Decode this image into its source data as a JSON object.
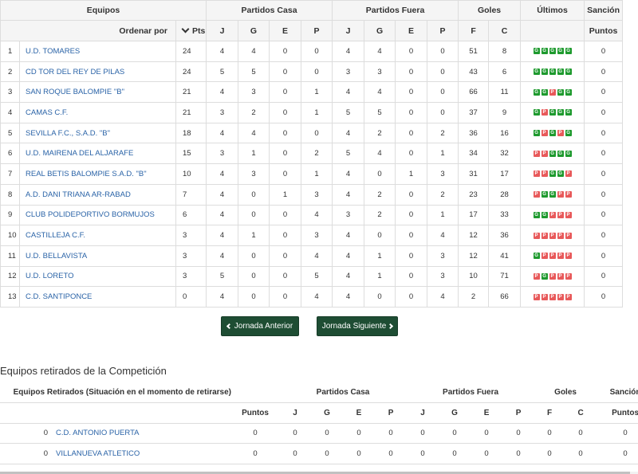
{
  "standings": {
    "header_groups": {
      "teams": "Equipos",
      "home": "Partidos Casa",
      "away": "Partidos Fuera",
      "goals": "Goles",
      "last": "Últimos",
      "penalty": "Sanción"
    },
    "order_by": "Ordenar por",
    "pts": "Pts",
    "cols": {
      "j": "J",
      "g": "G",
      "e": "E",
      "p": "P",
      "f": "F",
      "c": "C",
      "points": "Puntos"
    },
    "rows": [
      {
        "pos": "1",
        "team": "U.D. TOMARES",
        "pts": "24",
        "hj": "4",
        "hg": "4",
        "he": "0",
        "hp": "0",
        "aj": "4",
        "ag": "4",
        "ae": "0",
        "ap": "0",
        "f": "51",
        "c": "8",
        "last": [
          "G",
          "G",
          "G",
          "G",
          "G"
        ],
        "pen": "0"
      },
      {
        "pos": "2",
        "team": "CD TOR DEL REY DE PILAS",
        "pts": "24",
        "hj": "5",
        "hg": "5",
        "he": "0",
        "hp": "0",
        "aj": "3",
        "ag": "3",
        "ae": "0",
        "ap": "0",
        "f": "43",
        "c": "6",
        "last": [
          "G",
          "G",
          "G",
          "G",
          "G"
        ],
        "pen": "0"
      },
      {
        "pos": "3",
        "team": "SAN ROQUE BALOMPIE \"B\"",
        "pts": "21",
        "hj": "4",
        "hg": "3",
        "he": "0",
        "hp": "1",
        "aj": "4",
        "ag": "4",
        "ae": "0",
        "ap": "0",
        "f": "66",
        "c": "11",
        "last": [
          "G",
          "G",
          "P",
          "G",
          "G"
        ],
        "pen": "0"
      },
      {
        "pos": "4",
        "team": "CAMAS C.F.",
        "pts": "21",
        "hj": "3",
        "hg": "2",
        "he": "0",
        "hp": "1",
        "aj": "5",
        "ag": "5",
        "ae": "0",
        "ap": "0",
        "f": "37",
        "c": "9",
        "last": [
          "G",
          "P",
          "G",
          "G",
          "G"
        ],
        "pen": "0"
      },
      {
        "pos": "5",
        "team": "SEVILLA F.C., S.A.D. \"B\"",
        "pts": "18",
        "hj": "4",
        "hg": "4",
        "he": "0",
        "hp": "0",
        "aj": "4",
        "ag": "2",
        "ae": "0",
        "ap": "2",
        "f": "36",
        "c": "16",
        "last": [
          "G",
          "P",
          "G",
          "P",
          "G"
        ],
        "pen": "0"
      },
      {
        "pos": "6",
        "team": "U.D. MAIRENA DEL ALJARAFE",
        "pts": "15",
        "hj": "3",
        "hg": "1",
        "he": "0",
        "hp": "2",
        "aj": "5",
        "ag": "4",
        "ae": "0",
        "ap": "1",
        "f": "34",
        "c": "32",
        "last": [
          "P",
          "P",
          "G",
          "G",
          "G"
        ],
        "pen": "0"
      },
      {
        "pos": "7",
        "team": "REAL BETIS BALOMPIE S.A.D. \"B\"",
        "pts": "10",
        "hj": "4",
        "hg": "3",
        "he": "0",
        "hp": "1",
        "aj": "4",
        "ag": "0",
        "ae": "1",
        "ap": "3",
        "f": "31",
        "c": "17",
        "last": [
          "P",
          "P",
          "G",
          "G",
          "P"
        ],
        "pen": "0"
      },
      {
        "pos": "8",
        "team": "A.D. DANI TRIANA AR-RABAD",
        "pts": "7",
        "hj": "4",
        "hg": "0",
        "he": "1",
        "hp": "3",
        "aj": "4",
        "ag": "2",
        "ae": "0",
        "ap": "2",
        "f": "23",
        "c": "28",
        "last": [
          "P",
          "G",
          "G",
          "P",
          "P"
        ],
        "pen": "0"
      },
      {
        "pos": "9",
        "team": "CLUB POLIDEPORTIVO BORMUJOS",
        "pts": "6",
        "hj": "4",
        "hg": "0",
        "he": "0",
        "hp": "4",
        "aj": "3",
        "ag": "2",
        "ae": "0",
        "ap": "1",
        "f": "17",
        "c": "33",
        "last": [
          "G",
          "G",
          "P",
          "P",
          "P"
        ],
        "pen": "0"
      },
      {
        "pos": "10",
        "team": "CASTILLEJA C.F.",
        "pts": "3",
        "hj": "4",
        "hg": "1",
        "he": "0",
        "hp": "3",
        "aj": "4",
        "ag": "0",
        "ae": "0",
        "ap": "4",
        "f": "12",
        "c": "36",
        "last": [
          "P",
          "P",
          "P",
          "P",
          "P"
        ],
        "pen": "0"
      },
      {
        "pos": "11",
        "team": "U.D. BELLAVISTA",
        "pts": "3",
        "hj": "4",
        "hg": "0",
        "he": "0",
        "hp": "4",
        "aj": "4",
        "ag": "1",
        "ae": "0",
        "ap": "3",
        "f": "12",
        "c": "41",
        "last": [
          "G",
          "P",
          "P",
          "P",
          "P"
        ],
        "pen": "0"
      },
      {
        "pos": "12",
        "team": "U.D. LORETO",
        "pts": "3",
        "hj": "5",
        "hg": "0",
        "he": "0",
        "hp": "5",
        "aj": "4",
        "ag": "1",
        "ae": "0",
        "ap": "3",
        "f": "10",
        "c": "71",
        "last": [
          "P",
          "G",
          "P",
          "P",
          "P"
        ],
        "pen": "0"
      },
      {
        "pos": "13",
        "team": "C.D. SANTIPONCE",
        "pts": "0",
        "hj": "4",
        "hg": "0",
        "he": "0",
        "hp": "4",
        "aj": "4",
        "ag": "0",
        "ae": "0",
        "ap": "4",
        "f": "2",
        "c": "66",
        "last": [
          "P",
          "P",
          "P",
          "P",
          "P"
        ],
        "pen": "0"
      }
    ]
  },
  "buttons": {
    "prev": "Jornada Anterior",
    "next": "Jornada Siguiente"
  },
  "retired": {
    "title": "Equipos retirados de la Competición",
    "header_groups": {
      "teams": "Equipos Retirados (Situación en el momento de retirarse)",
      "home": "Partidos Casa",
      "away": "Partidos Fuera",
      "goals": "Goles",
      "penalty": "Sanción"
    },
    "cols": {
      "points": "Puntos",
      "j": "J",
      "g": "G",
      "e": "E",
      "p": "P",
      "f": "F",
      "c": "C"
    },
    "rows": [
      {
        "num": "0",
        "team": "C.D. ANTONIO PUERTA",
        "pts": "0",
        "hj": "0",
        "hg": "0",
        "he": "0",
        "hp": "0",
        "aj": "0",
        "ag": "0",
        "ae": "0",
        "ap": "0",
        "f": "0",
        "c": "0",
        "pen": "0"
      },
      {
        "num": "0",
        "team": "VILLANUEVA ATLETICO",
        "pts": "0",
        "hj": "0",
        "hg": "0",
        "he": "0",
        "hp": "0",
        "aj": "0",
        "ag": "0",
        "ae": "0",
        "ap": "0",
        "f": "0",
        "c": "0",
        "pen": "0"
      }
    ]
  },
  "colors": {
    "win": "#1e9a2e",
    "loss": "#e8595a",
    "button": "#1e4d33",
    "link": "#2a63a7"
  }
}
